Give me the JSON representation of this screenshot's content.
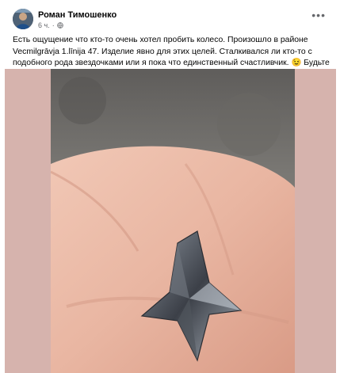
{
  "post": {
    "author_name": "Роман Тимошенко",
    "time": "6 ч.",
    "privacy_icon": "globe-icon",
    "more_icon": "more-options-icon",
    "text": "Есть ощущение что кто-то очень хотел пробить колесо. Произошло в районе Vecmilgrāvja 1.līnija 47. Изделие явно для этих целей. Сталкивался ли кто-то с подобного рода звездочками или я пока что единственный счастливчик. 😉  Будьте бдительны.",
    "photo_subject": "hand-holding-caltrop"
  },
  "colors": {
    "media_background": "#d6b3ad",
    "meta_text": "#65676b"
  }
}
